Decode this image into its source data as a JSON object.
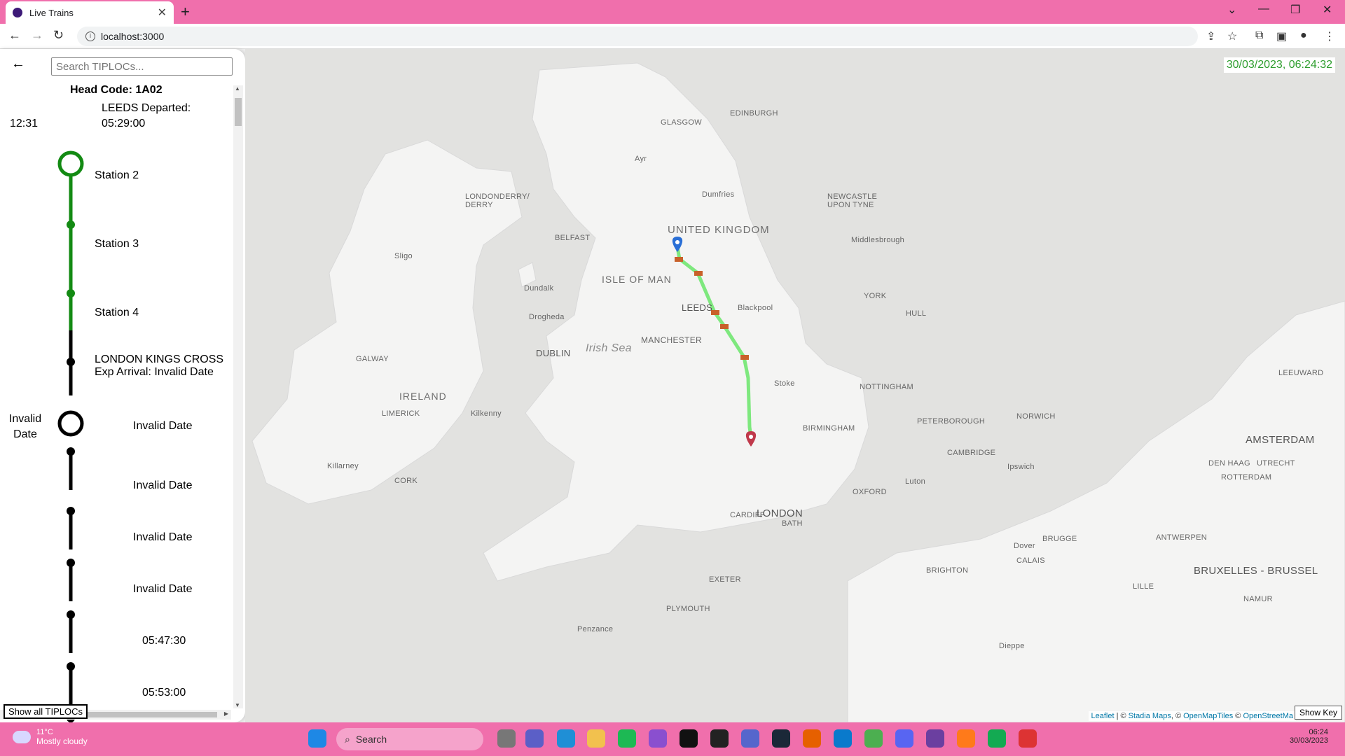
{
  "browser": {
    "tab_title": "Live Trains",
    "new_tab": "+",
    "url": "localhost:3000"
  },
  "sidebar": {
    "search_placeholder": "Search TIPLOCs...",
    "head_code": "Head Code: 1A02",
    "stops": [
      {
        "time": "12:31",
        "name": "LEEDS Departed:",
        "detail": "05:29:00"
      },
      {
        "name": "Station 2"
      },
      {
        "name": "Station 3"
      },
      {
        "name": "Station 4"
      },
      {
        "name": "LONDON KINGS CROSS",
        "detail": "Exp Arrival: Invalid Date"
      }
    ],
    "extra_time_left": "Invalid Date",
    "extra_rows": [
      "Invalid Date",
      "Invalid Date",
      "Invalid Date",
      "Invalid Date",
      "05:47:30",
      "05:53:00"
    ],
    "show_all_label": "Show all TIPLOCs",
    "colors": {
      "passed": "#138a13",
      "future": "#000000"
    }
  },
  "map": {
    "clock": "30/03/2023, 06:24:32",
    "show_key": "Show Key",
    "attribution": {
      "leaflet": "Leaflet",
      "stadia": "Stadia Maps",
      "omt": "OpenMapTiles",
      "osm": "OpenStreetMa"
    },
    "labels": {
      "edinburgh": "EDINBURGH",
      "glasgow": "GLASGOW",
      "ayr": "Ayr",
      "dumfries": "Dumfries",
      "newcastle": "NEWCASTLE UPON TYNE",
      "united_kingdom": "UNITED KINGDOM",
      "londonderry": "LONDONDERRY/ DERRY",
      "belfast": "BELFAST",
      "middlesbrough": "Middlesbrough",
      "sligo": "Sligo",
      "isle_of_man": "ISLE OF MAN",
      "dundalk": "Dundalk",
      "york": "YORK",
      "blackpool": "Blackpool",
      "leeds": "LEEDS",
      "hull": "HULL",
      "drogheda": "Drogheda",
      "manchester": "MANCHESTER",
      "irish_sea": "Irish Sea",
      "dublin": "DUBLIN",
      "galway": "GALWAY",
      "stoke": "Stoke",
      "nottingham": "NOTTINGHAM",
      "ireland": "IRELAND",
      "limerick": "LIMERICK",
      "kilkenny": "Kilkenny",
      "birmingham": "BIRMINGHAM",
      "peterborough": "PETERBOROUGH",
      "norwich": "NORWICH",
      "amsterdam": "AMSTERDAM",
      "cambridge": "CAMBRIDGE",
      "killarney": "Killarney",
      "cork": "CORK",
      "den_haag": "DEN HAAG",
      "utrecht": "UTRECHT",
      "ipswich": "Ipswich",
      "rotterdam": "ROTTERDAM",
      "luton": "Luton",
      "oxford": "OXFORD",
      "cardiff": "CARDIFF",
      "bath": "BATH",
      "london": "LONDON",
      "brugge": "BRUGGE",
      "antwerpen": "ANTWERPEN",
      "dover": "Dover",
      "calais": "CALAIS",
      "exeter": "EXETER",
      "brighton": "BRIGHTON",
      "bruxelles": "BRUXELLES - BRUSSEL",
      "lille": "LILLE",
      "namur": "NAMUR",
      "plymouth": "PLYMOUTH",
      "penzance": "Penzance",
      "dieppe": "Dieppe",
      "leeuwarden": "LEEUWARD"
    },
    "route_color": "#7ee87e",
    "origin_marker_color": "#2a6fd6",
    "dest_marker_color": "#c0394b"
  },
  "taskbar": {
    "weather_temp": "11°C",
    "weather_desc": "Mostly cloudy",
    "search": "Search",
    "time": "06:24",
    "date": "30/03/2023"
  }
}
